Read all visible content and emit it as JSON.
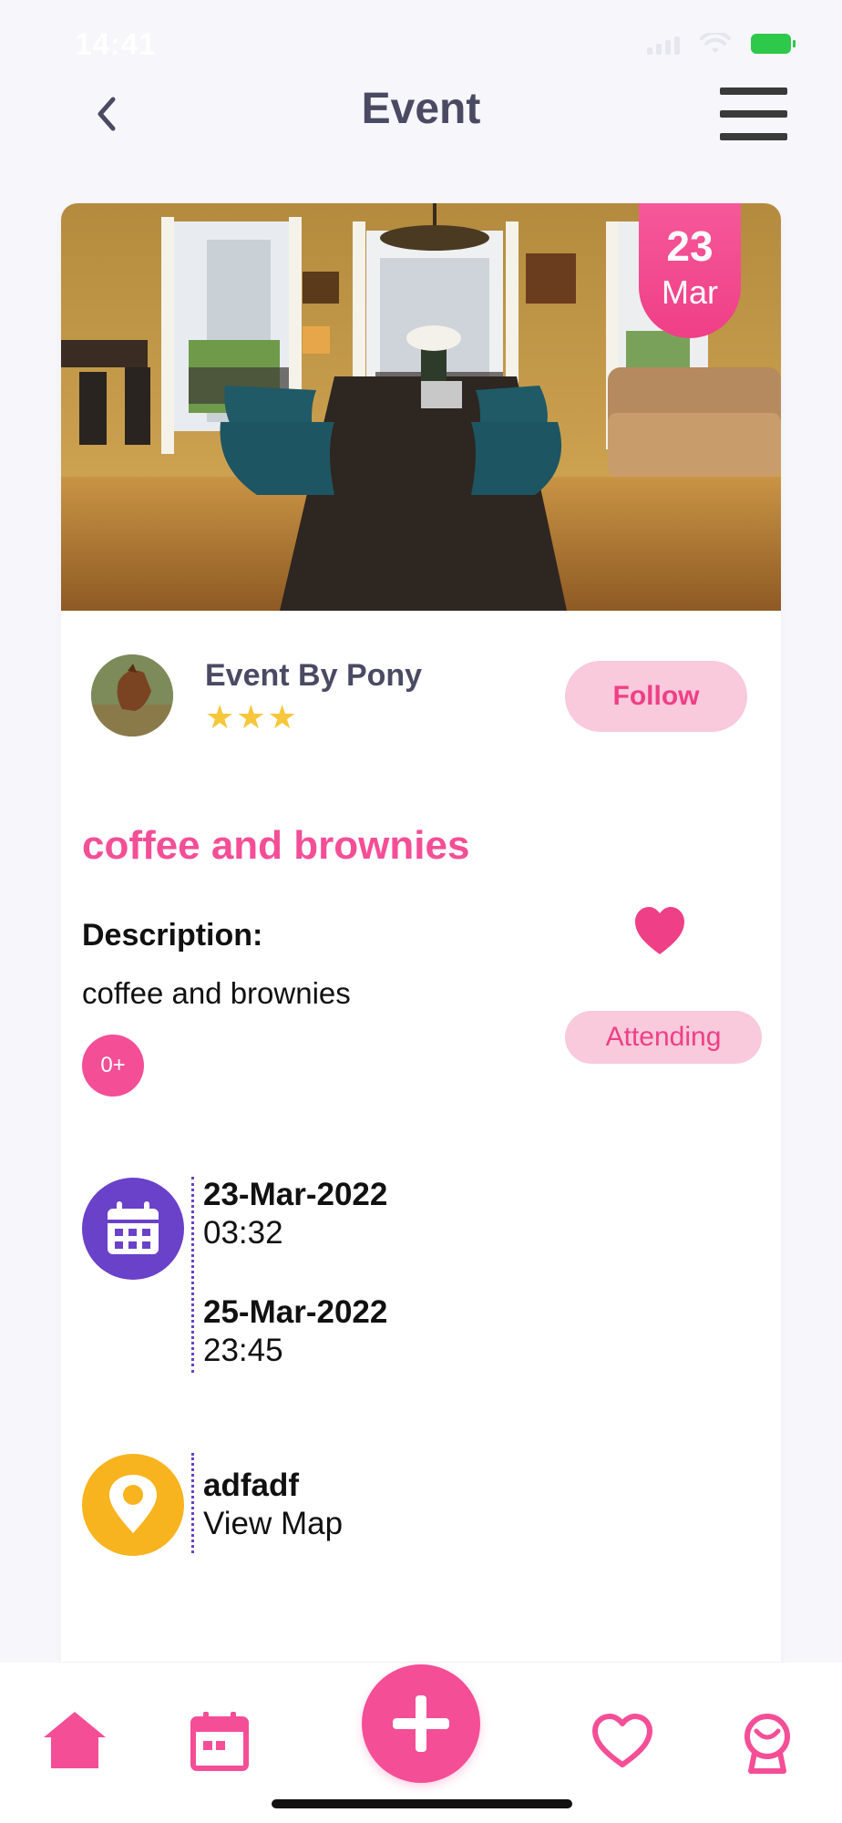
{
  "status_bar": {
    "time": "14:41"
  },
  "header": {
    "title": "Event"
  },
  "event": {
    "date_badge": {
      "day": "23",
      "month": "Mar"
    },
    "organizer": {
      "name": "Event By Pony",
      "stars": "★★★",
      "rating": 3
    },
    "follow_label": "Follow",
    "title": "coffee and brownies",
    "description_label": "Description:",
    "description": "coffee and brownies",
    "age_badge": "0+",
    "attending_label": "Attending",
    "start": {
      "date": "23-Mar-2022",
      "time": "03:32"
    },
    "end": {
      "date": "25-Mar-2022",
      "time": "23:45"
    },
    "location": {
      "name": "adfadf",
      "link_label": "View Map"
    }
  },
  "nav": {
    "items": [
      {
        "name": "home-icon"
      },
      {
        "name": "calendar-icon"
      },
      {
        "name": "add-icon"
      },
      {
        "name": "heart-icon"
      },
      {
        "name": "profile-icon"
      }
    ]
  },
  "colors": {
    "accent_pink": "#f44e97",
    "pink_light": "#f9c9dc",
    "purple": "#6a41c9",
    "yellow": "#f8b41e",
    "star": "#f7c73b",
    "title_gray": "#4a4a63"
  }
}
